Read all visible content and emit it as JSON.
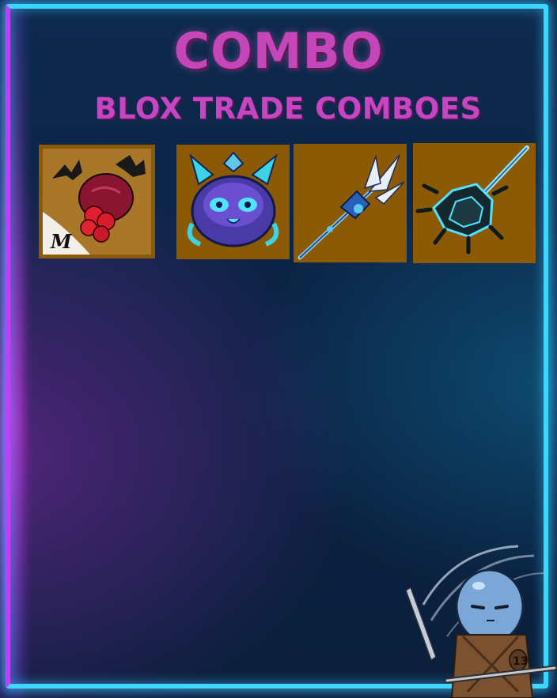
{
  "header": {
    "title": "COMBO",
    "subtitle": "BLOX TRADE COMBOES"
  },
  "items": [
    {
      "icon": "dough-fruit-icon",
      "badge": "M"
    },
    {
      "icon": "kitsune-fruit-icon"
    },
    {
      "icon": "trident-spear-icon"
    },
    {
      "icon": "spiked-mace-icon"
    }
  ],
  "mascot": {
    "icon": "ninja-blob-mascot-icon",
    "number": "13"
  },
  "colors": {
    "title": "#c446b8",
    "item_bg": "#8c5a04",
    "frame_cyan": "#39d7ff",
    "frame_magenta": "#c43dff"
  }
}
